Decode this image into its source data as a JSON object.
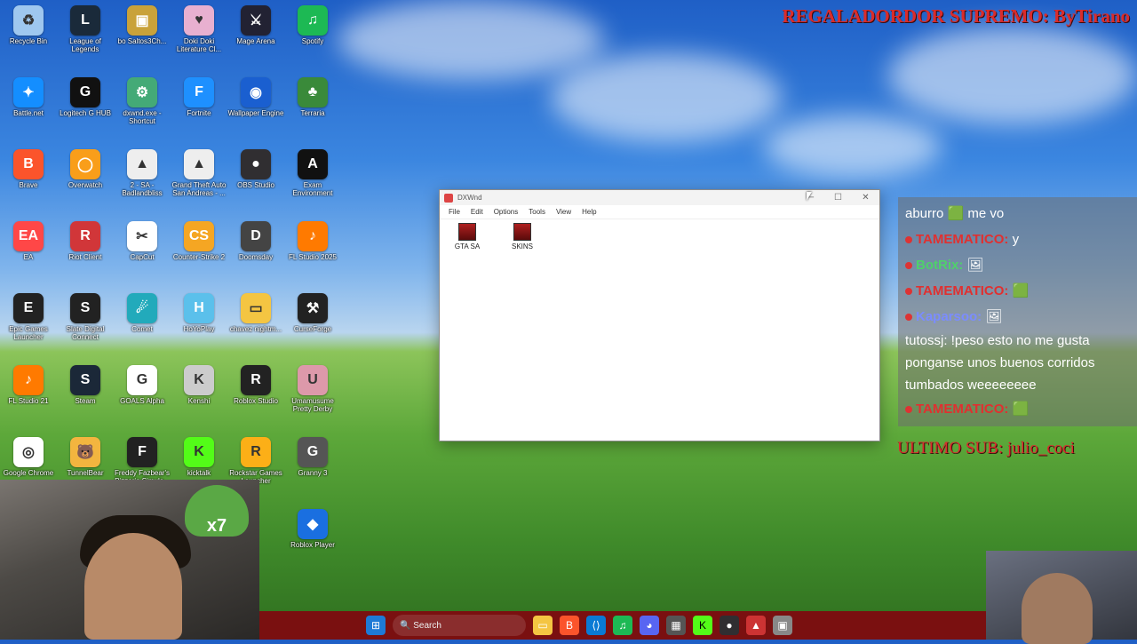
{
  "overlay": {
    "title": "REGALADORDOR SUPREMO: ByTirano",
    "last_sub": "ULTIMO SUB: julio_coci"
  },
  "desktop_icons": [
    {
      "label": "Recycle Bin",
      "color": "#9ec7ef",
      "glyph": "♻"
    },
    {
      "label": "League of Legends",
      "color": "#1a2a3a",
      "glyph": "L"
    },
    {
      "label": "bo Saltos3Ch...",
      "color": "#c9a23a",
      "glyph": "▣"
    },
    {
      "label": "Doki Doki Literature Cl...",
      "color": "#e8b0d0",
      "glyph": "♥"
    },
    {
      "label": "Mage Arena",
      "color": "#223",
      "glyph": "⚔"
    },
    {
      "label": "Spotify",
      "color": "#1db954",
      "glyph": "♫"
    },
    {
      "label": "Battle.net",
      "color": "#148eff",
      "glyph": "✦"
    },
    {
      "label": "Logitech G HUB",
      "color": "#111",
      "glyph": "G"
    },
    {
      "label": "dxwnd.exe - Shortcut",
      "color": "#4a7",
      "glyph": "⚙"
    },
    {
      "label": "Fortnite",
      "color": "#1e90ff",
      "glyph": "F"
    },
    {
      "label": "Wallpaper Engine",
      "color": "#1a5fd0",
      "glyph": "◉"
    },
    {
      "label": "Terraria",
      "color": "#3a8a3a",
      "glyph": "♣"
    },
    {
      "label": "Brave",
      "color": "#fb542b",
      "glyph": "B"
    },
    {
      "label": "Overwatch",
      "color": "#f99e1a",
      "glyph": "◯"
    },
    {
      "label": "2 - SA - Badlandbliss",
      "color": "#eee",
      "glyph": "▲"
    },
    {
      "label": "Grand Theft Auto San Andreas - ...",
      "color": "#eee",
      "glyph": "▲"
    },
    {
      "label": "OBS Studio",
      "color": "#302e31",
      "glyph": "●"
    },
    {
      "label": "Exam Environment",
      "color": "#111",
      "glyph": "A"
    },
    {
      "label": "EA",
      "color": "#ff4747",
      "glyph": "EA"
    },
    {
      "label": "Riot Client",
      "color": "#d13639",
      "glyph": "R"
    },
    {
      "label": "CapCut",
      "color": "#fff",
      "glyph": "✂"
    },
    {
      "label": "Counter-Strike 2",
      "color": "#f5a623",
      "glyph": "CS"
    },
    {
      "label": "Doomsday",
      "color": "#444",
      "glyph": "D"
    },
    {
      "label": "FL Studio 2025",
      "color": "#ff7a00",
      "glyph": "♪"
    },
    {
      "label": "Epic Games Launcher",
      "color": "#222",
      "glyph": "E"
    },
    {
      "label": "Slate Digital Connect",
      "color": "#222",
      "glyph": "S"
    },
    {
      "label": "Comet",
      "color": "#2ab",
      "glyph": "☄"
    },
    {
      "label": "HoYoPlay",
      "color": "#5bc0eb",
      "glyph": "H"
    },
    {
      "label": "chavez nightm...",
      "color": "#f4c542",
      "glyph": "▭"
    },
    {
      "label": "CurseForge",
      "color": "#222",
      "glyph": "⚒"
    },
    {
      "label": "FL Studio 21",
      "color": "#ff7a00",
      "glyph": "♪"
    },
    {
      "label": "Steam",
      "color": "#1b2838",
      "glyph": "S"
    },
    {
      "label": "GOALS Alpha",
      "color": "#fff",
      "glyph": "G"
    },
    {
      "label": "Kenshi",
      "color": "#ccc",
      "glyph": "K"
    },
    {
      "label": "Roblox Studio",
      "color": "#222",
      "glyph": "R"
    },
    {
      "label": "Umamusume Pretty Derby",
      "color": "#d9a",
      "glyph": "U"
    },
    {
      "label": "Google Chrome",
      "color": "#fff",
      "glyph": "◎"
    },
    {
      "label": "TunnelBear",
      "color": "#f3b53f",
      "glyph": "🐻"
    },
    {
      "label": "Freddy Fazbear's Pizzeria Simula...",
      "color": "#222",
      "glyph": "F"
    },
    {
      "label": "kicktalk",
      "color": "#53fc18",
      "glyph": "K"
    },
    {
      "label": "Rockstar Games Launcher",
      "color": "#fcaf17",
      "glyph": "R"
    },
    {
      "label": "Granny 3",
      "color": "#555",
      "glyph": "G"
    },
    {
      "label": "Roblox Player",
      "color": "#1a6fe0",
      "glyph": "◆"
    }
  ],
  "window": {
    "title": "DXWnd",
    "menu": [
      "File",
      "Edit",
      "Options",
      "Tools",
      "View",
      "Help"
    ],
    "files": [
      {
        "label": "GTA SA"
      },
      {
        "label": "SKINS"
      }
    ],
    "controls": {
      "minimize": "─",
      "maximize": "☐",
      "close": "✕"
    }
  },
  "chat": [
    {
      "user": "",
      "text": "aburro 🟩 me vo",
      "kind": "plain"
    },
    {
      "user": "TAMEMATICO:",
      "text": "y",
      "kind": "name"
    },
    {
      "user": "BotRix:",
      "text": "🖼",
      "kind": "bot"
    },
    {
      "user": "TAMEMATICO:",
      "text": "🟩",
      "kind": "name"
    },
    {
      "user": "Kaparsoo:",
      "text": "🖼",
      "kind": "kap"
    },
    {
      "user": "tutossj:",
      "text": "!peso esto no me gusta ponganse unos buenos corridos tumbados weeeeeeee",
      "kind": "plain"
    },
    {
      "user": "TAMEMATICO:",
      "text": "🟩",
      "kind": "name"
    }
  ],
  "webcam_overlay": {
    "badge": "x7"
  },
  "taskbar": {
    "search_placeholder": "Search"
  }
}
